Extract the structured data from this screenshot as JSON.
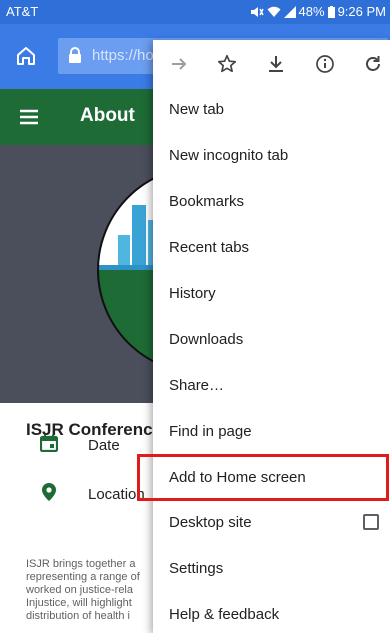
{
  "status_bar": {
    "carrier": "AT&T",
    "battery": "48%",
    "time": "9:26 PM"
  },
  "browser": {
    "url_text": "https://ho"
  },
  "site": {
    "header_title": "About",
    "conference_title": "ISJR Conference",
    "date_label": "Date",
    "location_label": "Location",
    "description_lines": [
      "ISJR brings together a",
      "representing a range of",
      "worked on justice-rela",
      "Injustice, will highlight",
      "distribution of health i"
    ]
  },
  "menu": {
    "items": [
      "New tab",
      "New incognito tab",
      "Bookmarks",
      "Recent tabs",
      "History",
      "Downloads",
      "Share…",
      "Find in page",
      "Add to Home screen",
      "Desktop site",
      "Settings",
      "Help & feedback"
    ],
    "desktop_site_checked": false,
    "highlighted_item": "Add to Home screen"
  },
  "colors": {
    "status_bar": "#2f6fd8",
    "toolbar": "#3b7be6",
    "site_header": "#1e6b36",
    "hero_bg": "#4a4f5b",
    "highlight": "#e11b1b",
    "icon_green": "#1e6b36"
  },
  "icons": {
    "toolbar": [
      "home-icon",
      "lock-icon"
    ],
    "menu_row": [
      "forward-arrow-icon",
      "star-icon",
      "download-icon",
      "info-icon",
      "refresh-icon"
    ],
    "content": [
      "calendar-icon",
      "location-pin-icon"
    ]
  }
}
